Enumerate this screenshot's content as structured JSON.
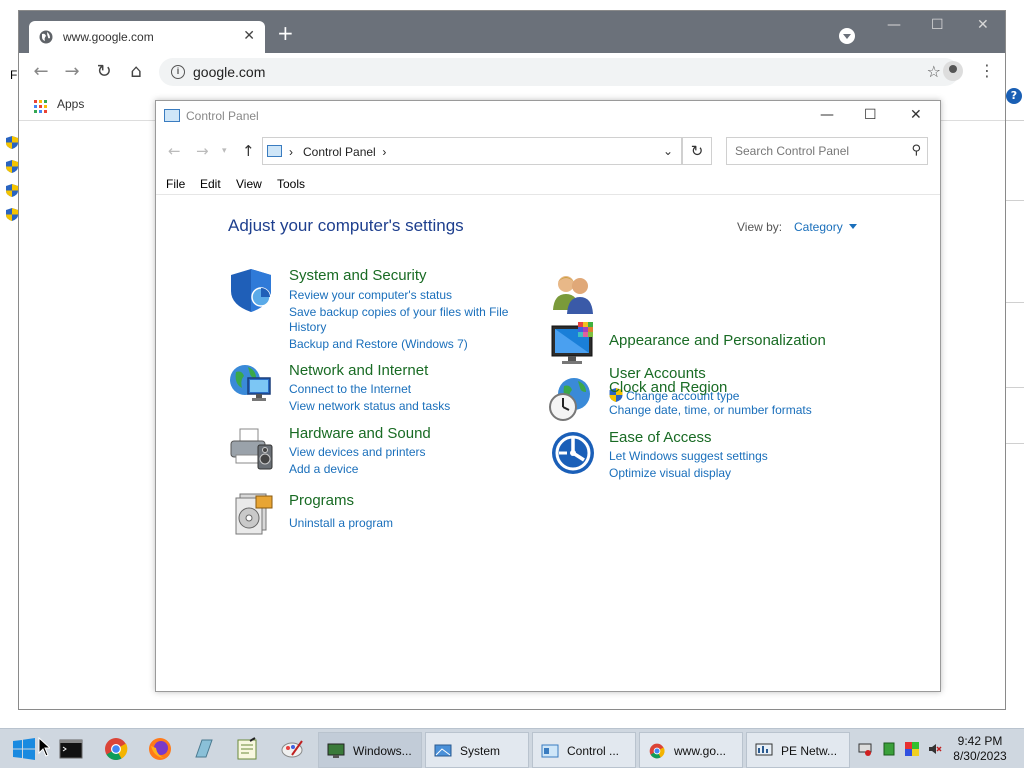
{
  "chrome": {
    "tab_title": "www.google.com",
    "url": "google.com",
    "bookmarks_apps_label": "Apps",
    "side_text": "Fi"
  },
  "control_panel": {
    "window_title": "Control Panel",
    "breadcrumb": "Control Panel",
    "search_placeholder": "Search Control Panel",
    "menu": [
      "File",
      "Edit",
      "View",
      "Tools"
    ],
    "heading": "Adjust your computer's settings",
    "view_by_label": "View by:",
    "view_by_value": "Category",
    "categories": [
      {
        "title": "System and Security",
        "icon": "shield-icon",
        "links": [
          "Review your computer's status",
          "Save backup copies of your files with File",
          "History",
          "Backup and Restore (Windows 7)"
        ]
      },
      {
        "title": "Network and Internet",
        "icon": "network-icon",
        "links": [
          "Connect to the Internet",
          "View network status and tasks"
        ]
      },
      {
        "title": "Hardware and Sound",
        "icon": "printer-icon",
        "links": [
          "View devices and printers",
          "Add a device"
        ]
      },
      {
        "title": "Programs",
        "icon": "programs-icon",
        "links": [
          "Uninstall a program"
        ]
      },
      {
        "title": "User Accounts",
        "icon": "users-icon",
        "links": [
          "Change account type"
        ]
      },
      {
        "title": "Appearance and Personalization",
        "icon": "monitor-icon",
        "links": []
      },
      {
        "title": "Clock and Region",
        "icon": "clock-icon",
        "links": [
          "Change date, time, or number formats"
        ]
      },
      {
        "title": "Ease of Access",
        "icon": "ease-of-access-icon",
        "links": [
          "Let Windows suggest settings",
          "Optimize visual display"
        ]
      }
    ]
  },
  "taskbar": {
    "buttons": [
      "Windows...",
      "System",
      "Control ...",
      "www.go...",
      "PE Netw..."
    ],
    "time": "9:42 PM",
    "date": "8/30/2023"
  },
  "colors": {
    "link": "#1a6fbb",
    "category_title": "#196b24",
    "heading": "#1e3f8e",
    "chrome_frame": "#6b717a"
  }
}
